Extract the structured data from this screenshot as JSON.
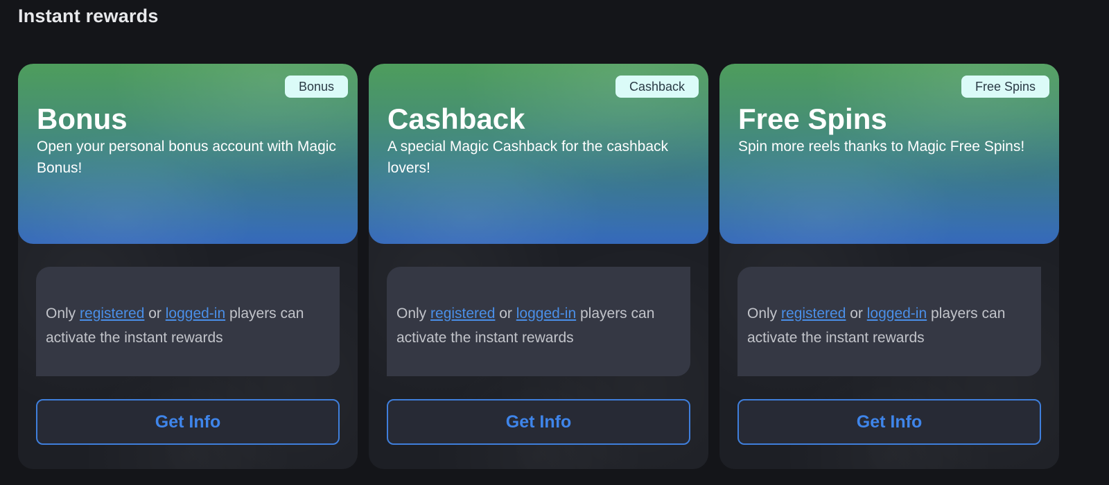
{
  "section": {
    "title": "Instant rewards"
  },
  "notice": {
    "prefix": "Only ",
    "registered_link": "registered",
    "middle": " or ",
    "login_link": "logged-in",
    "suffix": " players can activate the instant rewards"
  },
  "cards": [
    {
      "badge": "Bonus",
      "title": "Bonus",
      "description": "Open your personal bonus account with Magic Bonus!",
      "button": "Get Info"
    },
    {
      "badge": "Cashback",
      "title": "Cashback",
      "description": "A special Magic Cashback for the cashback lovers!",
      "button": "Get Info"
    },
    {
      "badge": "Free Spins",
      "title": "Free Spins",
      "description": "Spin more reels thanks to Magic Free Spins!",
      "button": "Get Info"
    }
  ],
  "colors": {
    "background": "#141519",
    "card": "#1d1f25",
    "hero_top": "#4e9d5c",
    "hero_bottom": "#3569bb",
    "badge": "#dbfbf8",
    "notice": "#353844",
    "link": "#4a8fe8",
    "button_border": "#3f7fdc"
  }
}
